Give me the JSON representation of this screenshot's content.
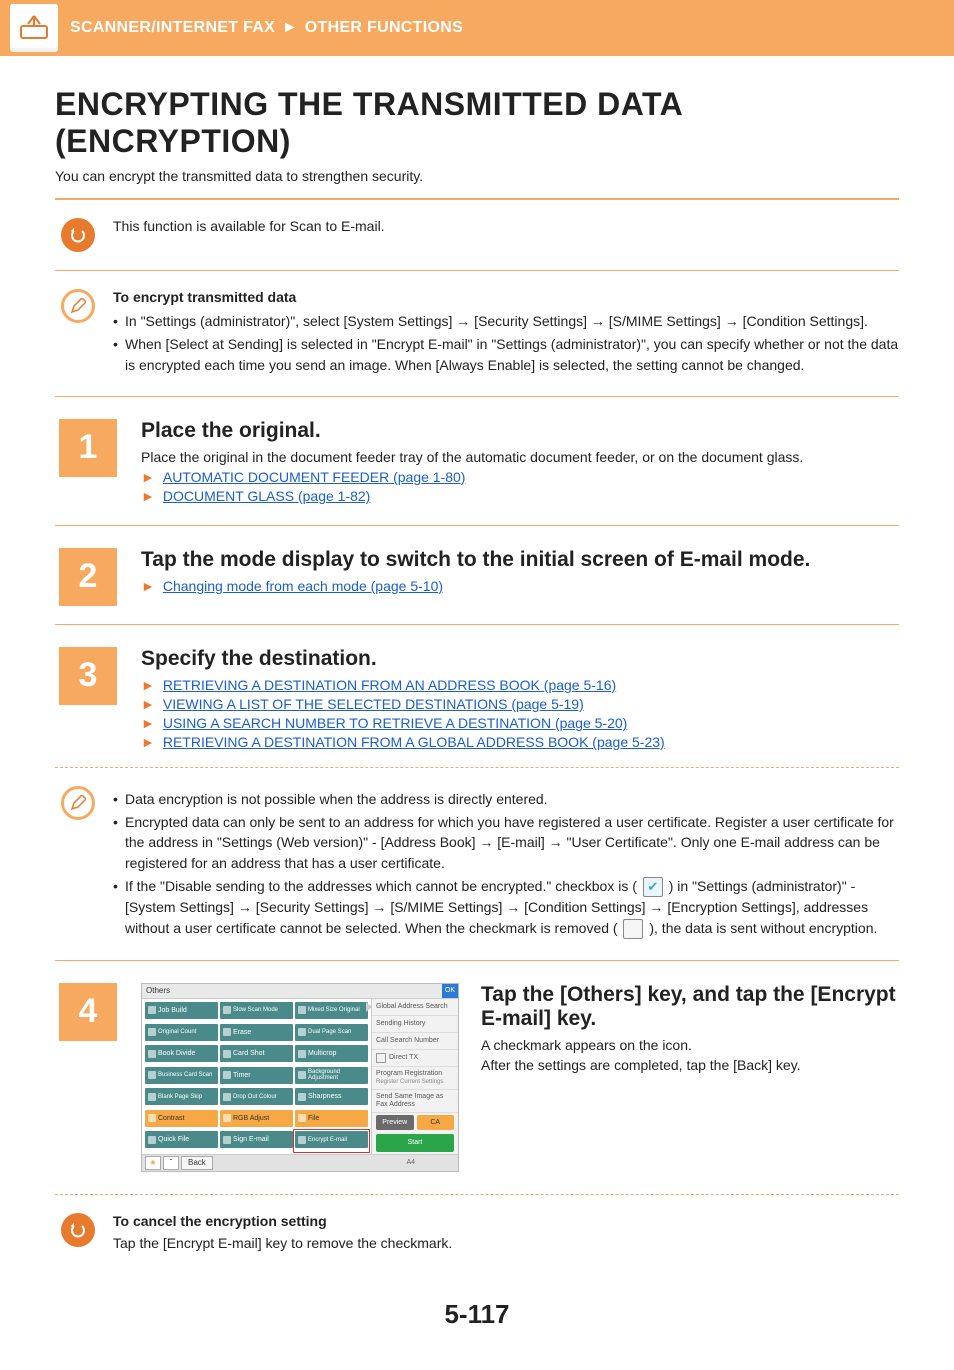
{
  "breadcrumb": {
    "a": "SCANNER/INTERNET FAX",
    "sep": "►",
    "b": "OTHER FUNCTIONS"
  },
  "title": "ENCRYPTING THE TRANSMITTED DATA (ENCRYPTION)",
  "intro": "You can encrypt the transmitted data to strengthen security.",
  "note_avail": "This function is available for Scan to E-mail.",
  "encrypt_note": {
    "heading": "To encrypt transmitted data",
    "b1": "In \"Settings (administrator)\", select [System Settings] → [Security Settings] → [S/MIME Settings] → [Condition Settings].",
    "b2": "When [Select at Sending] is selected in \"Encrypt E-mail\" in \"Settings (administrator)\", you can specify whether or not the data is encrypted each time you send an image. When [Always Enable] is selected, the setting cannot be changed."
  },
  "steps": {
    "s1": {
      "n": "1",
      "title": "Place the original.",
      "text": "Place the original in the document feeder tray of the automatic document feeder, or on the document glass.",
      "link1": "AUTOMATIC DOCUMENT FEEDER (page 1-80)",
      "link2": "DOCUMENT GLASS (page 1-82)"
    },
    "s2": {
      "n": "2",
      "title": "Tap the mode display to switch to the initial screen of E-mail mode.",
      "link1": "Changing mode from each mode (page 5-10)"
    },
    "s3": {
      "n": "3",
      "title": "Specify the destination.",
      "link1": "RETRIEVING A DESTINATION FROM AN ADDRESS BOOK (page 5-16)",
      "link2": "VIEWING A LIST OF THE SELECTED DESTINATIONS (page 5-19)",
      "link3": "USING A SEARCH NUMBER TO RETRIEVE A DESTINATION (page 5-20)",
      "link4": "RETRIEVING A DESTINATION FROM A GLOBAL ADDRESS BOOK (page 5-23)"
    },
    "s3_notes": {
      "b1": "Data encryption is not possible when the address is directly entered.",
      "b2": "Encrypted data can only be sent to an address for which you have registered a user certificate. Register a user certificate for the address in  \"Settings (Web version)\" - [Address Book] → [E-mail] → \"User Certificate\". Only one E-mail address can be registered for an address that has a user certificate.",
      "b3a": "If the \"Disable sending to the addresses which cannot be encrypted.\" checkbox is (",
      "b3b": ") in \"Settings (administrator)\" - [System Settings] → [Security Settings] → [S/MIME Settings] → [Condition Settings] → [Encryption Settings], addresses without a user certificate cannot be selected. When the checkmark is removed (",
      "b3c": "), the data is sent without encryption."
    },
    "s4": {
      "n": "4",
      "title": "Tap the [Others] key, and tap the [Encrypt E-mail] key.",
      "p1": "A checkmark appears on the icon.",
      "p2": "After the settings are completed, tap the [Back] key."
    }
  },
  "cancel": {
    "heading": "To cancel the encryption setting",
    "text": "Tap the [Encrypt E-mail] key to remove the checkmark."
  },
  "ui": {
    "header": "Others",
    "ok": "OK",
    "grid": [
      "Job Build",
      "Slow Scan Mode",
      "Mixed Size Original",
      "Original Count",
      "Erase",
      "Dual Page Scan",
      "Book Divide",
      "Card Shot",
      "Multicrop",
      "Business Card Scan",
      "Timer",
      "Background Adjustment",
      "Blank Page Skip",
      "Drop Out Colour",
      "Sharpness",
      "Contrast",
      "RGB Adjust",
      "File",
      "Quick File",
      "Sign E-mail",
      "Encrypt E-mail"
    ],
    "side": {
      "gsearch": "Global Address Search",
      "hist": "Sending History",
      "callnum": "Call Search Number",
      "direct": "Direct TX",
      "prog": "Program Registration",
      "prog_sub": "Register Current Settings",
      "sendsame": "Send Same Image as Fax Address",
      "preview": "Preview",
      "ca": "CA",
      "start": "Start"
    },
    "foot": {
      "back": "Back",
      "a4": "A4"
    }
  },
  "page_number": "5-117"
}
